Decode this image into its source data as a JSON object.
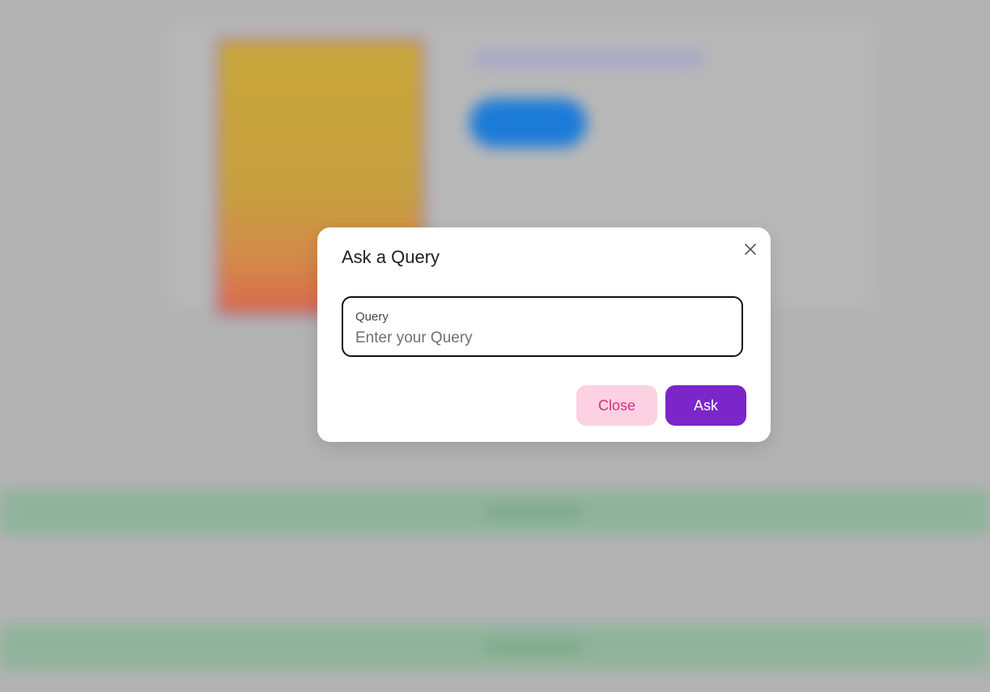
{
  "modal": {
    "title": "Ask a Query",
    "close_icon": "close-icon",
    "query_field": {
      "label": "Query",
      "value": "",
      "placeholder": "Enter your Query"
    },
    "buttons": {
      "close_label": "Close",
      "ask_label": "Ask"
    }
  },
  "colors": {
    "ask_button_bg": "#7b26c9",
    "close_button_bg": "#fcd2e2",
    "close_button_text": "#d4307a",
    "overlay": "#b3b3b3"
  }
}
